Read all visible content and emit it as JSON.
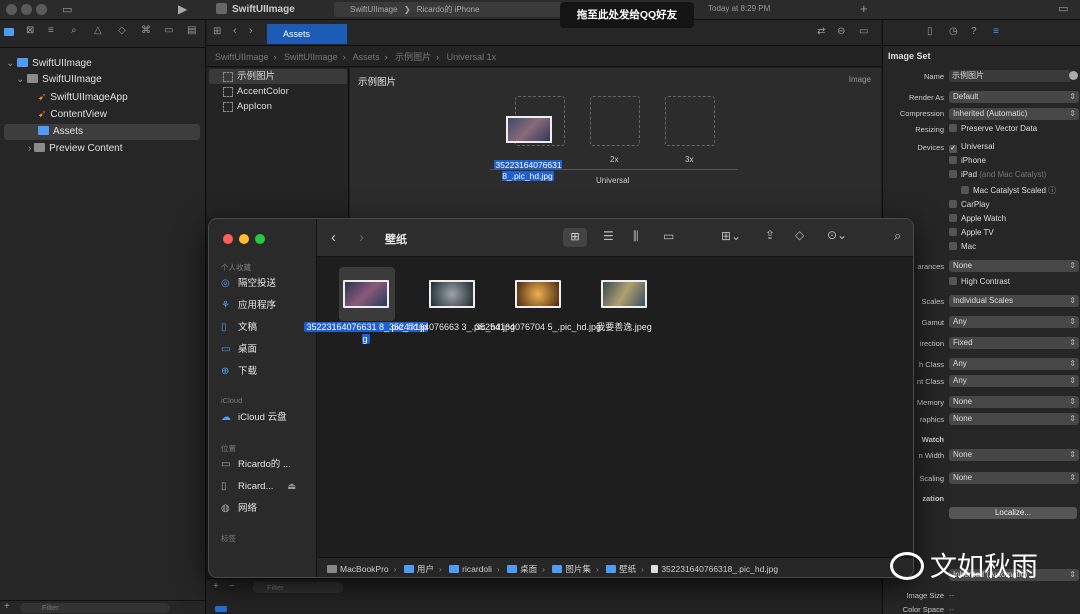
{
  "titlebar": {
    "project": "SwiftUIImage",
    "run_tab": "SwiftUIImage",
    "device": "Ricardo的 iPhone",
    "status": "Today at 8:29 PM"
  },
  "banner": "拖至此处发给QQ好友",
  "navigator": {
    "items": [
      {
        "label": "SwiftUIImage",
        "kind": "project"
      },
      {
        "label": "SwiftUIImage",
        "kind": "folder"
      },
      {
        "label": "SwiftUIImageApp",
        "kind": "swift"
      },
      {
        "label": "ContentView",
        "kind": "swift"
      },
      {
        "label": "Assets",
        "kind": "assets",
        "selected": true
      },
      {
        "label": "Preview Content",
        "kind": "folder"
      }
    ],
    "filter_placeholder": "Filter"
  },
  "editor": {
    "tab": "Assets",
    "jumpbar": [
      "SwiftUIImage",
      "SwiftUIImage",
      "Assets",
      "示例图片",
      "Universal 1x"
    ],
    "assets": [
      "示例图片",
      "AccentColor",
      "AppIcon"
    ],
    "imageset_title": "示例图片",
    "imageset_kind": "Image",
    "slot_labels": [
      "2x",
      "3x"
    ],
    "slot_selected_name": "35223164076631 8_.pic_hd.jpg",
    "group_label": "Universal",
    "bottom_filter": "Filter"
  },
  "inspector": {
    "section": "Image Set",
    "name_label": "Name",
    "name_value": "示例图片",
    "render_as_label": "Render As",
    "render_as": "Default",
    "compression_label": "Compression",
    "compression": "Inherited (Automatic)",
    "resizing_label": "Resizing",
    "preserve_vector": "Preserve Vector Data",
    "devices_label": "Devices",
    "devices": [
      {
        "label": "Universal",
        "checked": true
      },
      {
        "label": "iPhone",
        "checked": false
      },
      {
        "label": "iPad",
        "suffix": "(and Mac Catalyst)",
        "checked": false
      },
      {
        "label": "Mac Catalyst Scaled",
        "checked": false
      },
      {
        "label": "CarPlay",
        "checked": false
      },
      {
        "label": "Apple Watch",
        "checked": false
      },
      {
        "label": "Apple TV",
        "checked": false
      },
      {
        "label": "Mac",
        "checked": false
      }
    ],
    "appearances_label": "arances",
    "appearances": "None",
    "high_contrast": "High Contrast",
    "scales_label": "Scales",
    "scales": "Individual Scales",
    "gamut_label": "Gamut",
    "gamut": "Any",
    "direction_label": "irection",
    "direction": "Fixed",
    "width_class_label": "h Class",
    "width_class": "Any",
    "height_class_label": "nt Class",
    "height_class": "Any",
    "memory_label": "Memory",
    "memory": "None",
    "graphics_label": "raphics",
    "graphics": "None",
    "watch_label": "Watch",
    "watch_width_label": "n Width",
    "watch_width": "None",
    "scaling_label": "Scaling",
    "scaling": "None",
    "localization_label": "zation",
    "localize_button": "Localize...",
    "image_size_label": "Image Size",
    "image_size": "--",
    "color_space_label": "Color Space",
    "color_space": "--",
    "partial_lower": "Inherited (Automatic)"
  },
  "finder": {
    "title": "壁纸",
    "sidebar": {
      "favorites_header": "个人收藏",
      "favorites": [
        "隔空投送",
        "应用程序",
        "文稿",
        "桌面",
        "下载"
      ],
      "icloud_header": "iCloud",
      "icloud": [
        "iCloud 云盘"
      ],
      "locations_header": "位置",
      "locations": [
        "Ricardo的 ...",
        "Ricard...",
        "网络"
      ],
      "tags_header": "标签"
    },
    "files": [
      {
        "name": "35223164076631 8_.pic_hd.jpg",
        "selected": true,
        "color": "#5b6a86"
      },
      {
        "name": "35247164076663 3_.pic_hd.jpg",
        "selected": false,
        "color": "#4c5a66"
      },
      {
        "name": "35254164076704 5_.pic_hd.jpg",
        "selected": false,
        "color": "#7a4a22"
      },
      {
        "name": "我要善逸.jpeg",
        "selected": false,
        "color": "#5a6a74"
      }
    ],
    "path": [
      "MacBookPro",
      "用户",
      "ricardoli",
      "桌面",
      "图片集",
      "壁纸",
      "352231640766318_.pic_hd.jpg"
    ]
  },
  "watermark": "文如秋雨"
}
